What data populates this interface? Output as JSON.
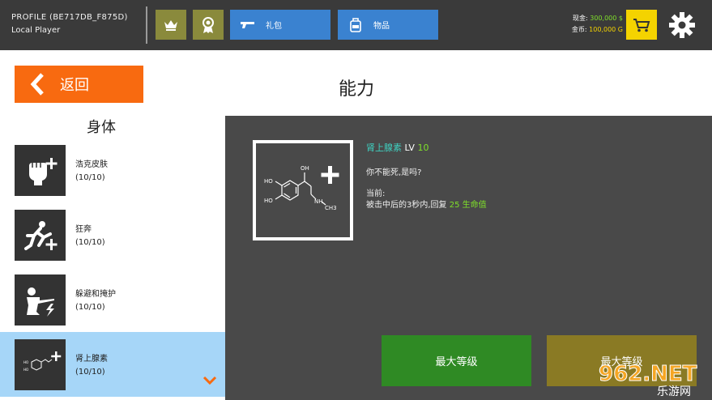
{
  "header": {
    "profile_name": "PROFILE (BE717DB_F875D)",
    "player_name": "Local Player",
    "gift_label": "礼包",
    "items_label": "物品",
    "cash_label": "现金:",
    "cash_value": "300,000 $",
    "gold_label": "金币:",
    "gold_value": "100,000 G",
    "icons": [
      "crown-icon",
      "medal-icon",
      "pistol-icon",
      "backpack-icon",
      "cart-icon",
      "gear-icon"
    ]
  },
  "back": {
    "label": "返回"
  },
  "page_title": "能力",
  "list": {
    "header": "身体",
    "items": [
      {
        "name": "浩克皮肤",
        "level": "(10/10)",
        "icon": "fist-plus-icon"
      },
      {
        "name": "狂奔",
        "level": "(10/10)",
        "icon": "runner-plus-icon"
      },
      {
        "name": "躲避和掩护",
        "level": "(10/10)",
        "icon": "soldier-bolt-icon"
      },
      {
        "name": "肾上腺素",
        "level": "(10/10)",
        "icon": "molecule-plus-icon"
      }
    ]
  },
  "detail": {
    "skill_name": "肾上腺素",
    "lv_label": "LV",
    "lv_value": "10",
    "quote": "你不能死,是吗?",
    "current_label": "当前:",
    "effect_prefix": "被击中后的3秒内,回复",
    "effect_value": "25",
    "effect_suffix": "生命值",
    "molecule": {
      "oh1": "HO",
      "oh2": "HO",
      "oh3": "OH",
      "nh": "NH",
      "ch3": "CH3"
    },
    "max_button_1": "最大等级",
    "max_button_2": "最大等级"
  },
  "watermark": {
    "brand": "962.NET",
    "sub": "乐游网"
  },
  "colors": {
    "topbar": "#3a3a3a",
    "blue_button": "#3a82d0",
    "olive_button": "#8a8a3c",
    "cart": "#f4d300",
    "back": "#f86a10",
    "selected_row": "#a6d6f8",
    "detail_panel": "#494949",
    "green_button": "#2f8a24",
    "gold_button": "#8a7a24",
    "cash_text": "#7fe02a",
    "gold_text": "#f4d300",
    "skill_name": "#3fd0c0"
  }
}
